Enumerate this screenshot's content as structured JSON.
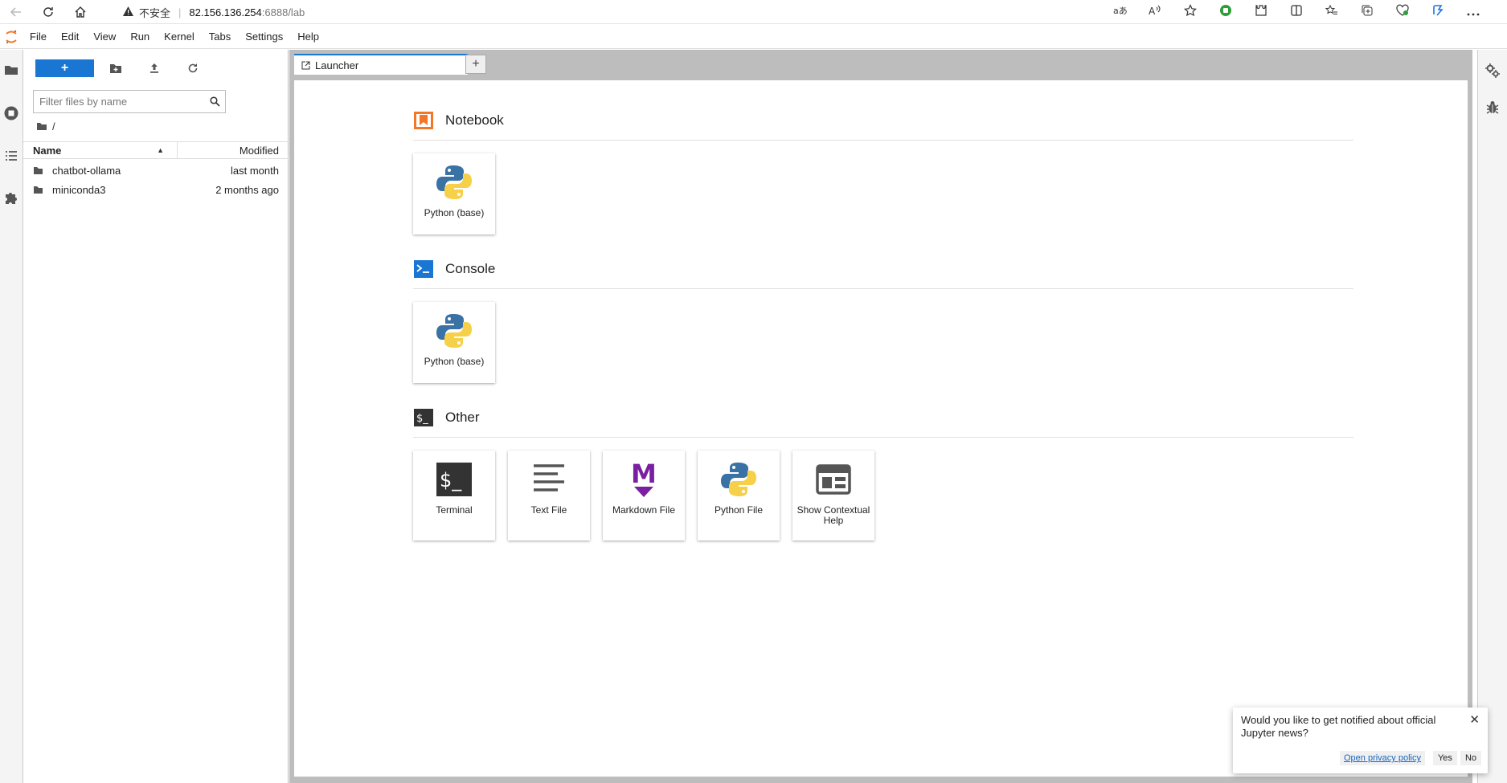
{
  "browser": {
    "insecure_label": "不安全",
    "url_host": "82.156.136.254",
    "url_rest": ":6888/lab",
    "colors": {
      "accent": "#1a73e8",
      "green": "#2e9d3a"
    }
  },
  "menubar": {
    "items": [
      "File",
      "Edit",
      "View",
      "Run",
      "Kernel",
      "Tabs",
      "Settings",
      "Help"
    ]
  },
  "filebrowser": {
    "new_label": "+",
    "filter_placeholder": "Filter files by name",
    "breadcrumb": "/",
    "columns": {
      "name": "Name",
      "modified": "Modified"
    },
    "files": [
      {
        "name": "chatbot-ollama",
        "modified": "last month"
      },
      {
        "name": "miniconda3",
        "modified": "2 months ago"
      }
    ]
  },
  "tabs": {
    "active_label": "Launcher",
    "add_label": "+"
  },
  "launcher": {
    "notebook": {
      "title": "Notebook",
      "cards": [
        {
          "label": "Python (base)",
          "icon": "python-icon"
        }
      ]
    },
    "console": {
      "title": "Console",
      "cards": [
        {
          "label": "Python (base)",
          "icon": "python-icon"
        }
      ]
    },
    "other": {
      "title": "Other",
      "cards": [
        {
          "label": "Terminal",
          "icon": "terminal-icon"
        },
        {
          "label": "Text File",
          "icon": "text-file-icon"
        },
        {
          "label": "Markdown File",
          "icon": "markdown-icon"
        },
        {
          "label": "Python File",
          "icon": "python-icon"
        },
        {
          "label": "Show Contextual Help",
          "icon": "contextual-help-icon"
        }
      ]
    },
    "colors": {
      "notebook": "#f37726",
      "console": "#1976d2",
      "other": "#333333",
      "markdown": "#7b1fa2"
    }
  },
  "toast": {
    "message": "Would you like to get notified about official Jupyter news?",
    "link_label": "Open privacy policy",
    "yes_label": "Yes",
    "no_label": "No",
    "close_label": "✕"
  }
}
